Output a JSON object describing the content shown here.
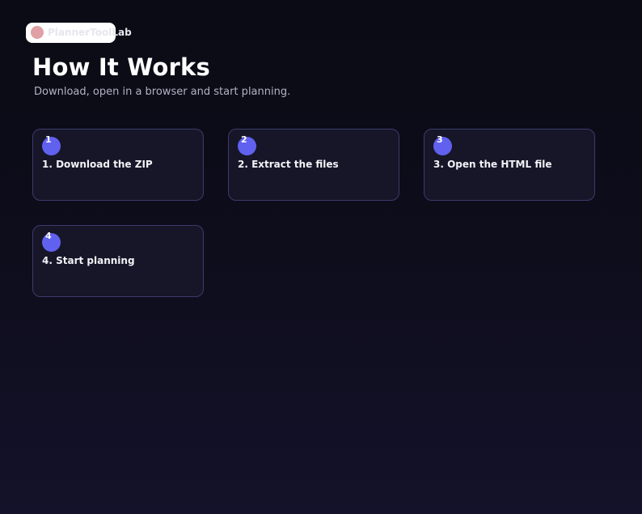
{
  "logo": {
    "text": "PlannerToolLab"
  },
  "header": {
    "title": "How It Works",
    "subtitle": "Download, open in a browser and start planning."
  },
  "steps": [
    {
      "number": "1",
      "title": "1. Download the ZIP"
    },
    {
      "number": "2",
      "title": "2. Extract the files"
    },
    {
      "number": "3",
      "title": "3. Open the HTML file"
    },
    {
      "number": "4",
      "title": "4. Start planning"
    }
  ],
  "colors": {
    "accent": "#6161ef",
    "card_border": "#3c3a6e",
    "card_background": "#171628",
    "page_background": "#0a0b14"
  }
}
